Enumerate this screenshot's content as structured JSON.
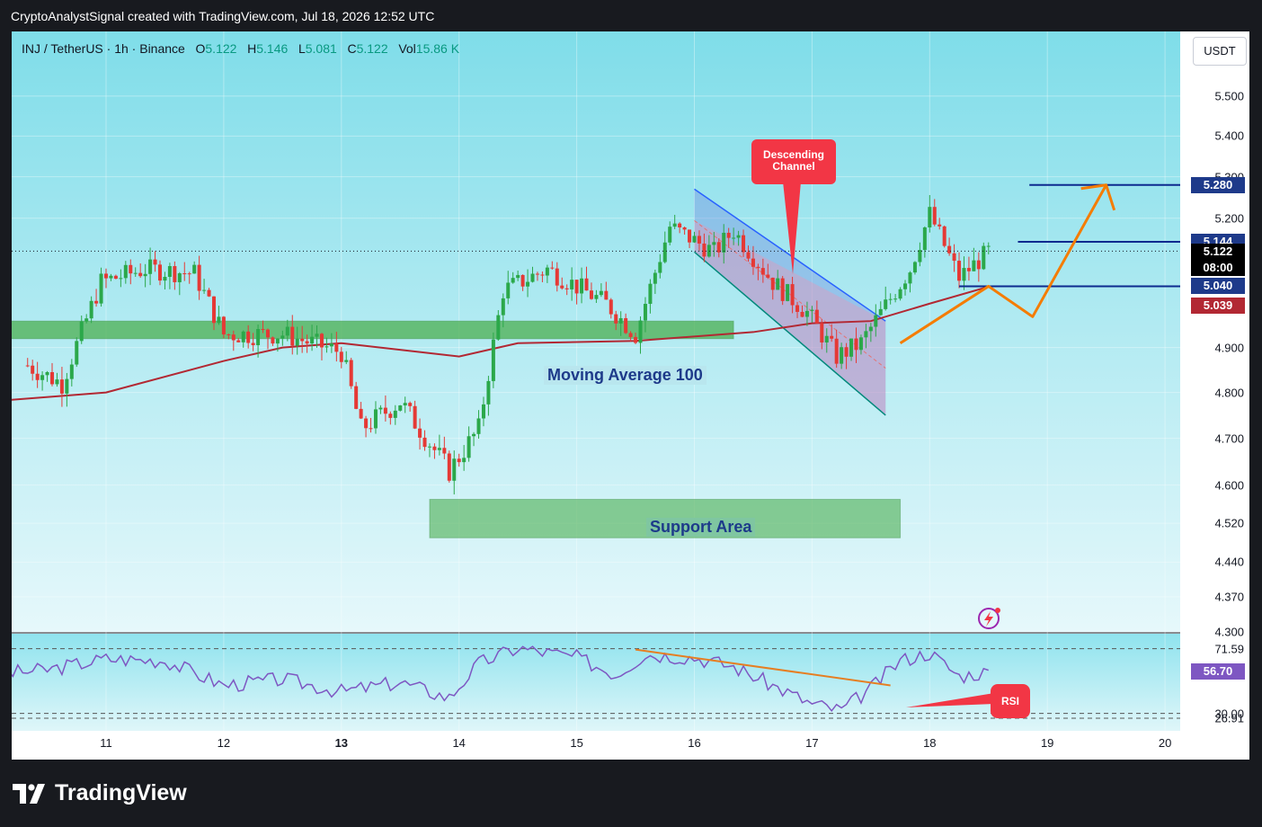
{
  "header": {
    "attribution": "CryptoAnalystSignal created with TradingView.com, Jul 18, 2026 12:52 UTC"
  },
  "symbol": {
    "name": "INJ / TetherUS · 1h · Binance",
    "o_label": "O",
    "o": "5.122",
    "h_label": "H",
    "h": "5.146",
    "l_label": "L",
    "l": "5.081",
    "c_label": "C",
    "c": "5.122",
    "vol_label": "Vol",
    "vol": "15.86 K"
  },
  "currency_button": "USDT",
  "price_axis": {
    "ticks": [
      "5.500",
      "5.400",
      "5.300",
      "5.200",
      "4.900",
      "4.800",
      "4.700",
      "4.600",
      "4.520",
      "4.440",
      "4.370",
      "4.300"
    ],
    "badges": [
      {
        "label": "5.280",
        "color": "#1e3a8a"
      },
      {
        "label": "5.144",
        "color": "#1e3a8a"
      },
      {
        "label": "5.122",
        "color": "#000000"
      },
      {
        "label": "08:00",
        "color": "#000000"
      },
      {
        "label": "5.040",
        "color": "#1e3a8a"
      },
      {
        "label": "5.039",
        "color": "#b22833"
      }
    ]
  },
  "rsi_axis": {
    "ticks": [
      "71.59",
      "30.00",
      "26.91"
    ],
    "badge": {
      "label": "56.70",
      "color": "#7e57c2"
    }
  },
  "time_axis": {
    "labels": [
      "11",
      "12",
      "13",
      "14",
      "15",
      "16",
      "17",
      "18",
      "19",
      "20"
    ]
  },
  "annotations": {
    "moving_average": "Moving Average 100",
    "support_area": "Support Area",
    "descending_channel": [
      "Descending",
      "Channel"
    ],
    "rsi": "RSI"
  },
  "colors": {
    "background_top": "#7fdde9",
    "background_bottom": "#e0f7fa",
    "up": "#2ba84a",
    "down": "#e53935",
    "ma": "#b22833",
    "rsi_line": "#7e57c2",
    "zone": "#4caf50",
    "projection": "#f57c00",
    "level_line": "#0d2a8f"
  },
  "icons": [
    "tradingview-logo-icon",
    "alert-bolt-icon"
  ],
  "chart_data": {
    "type": "candlestick",
    "symbol": "INJ / TetherUS",
    "interval": "1h",
    "exchange": "Binance",
    "time_range": [
      "2026-07-10",
      "2026-07-20"
    ],
    "ylim": [
      4.3,
      5.55
    ],
    "price_path": [
      [
        "2026-07-10T08:00",
        4.86
      ],
      [
        "2026-07-10T15:00",
        4.82
      ],
      [
        "2026-07-10T23:00",
        5.05
      ],
      [
        "2026-07-11T08:00",
        5.08
      ],
      [
        "2026-07-11T18:00",
        5.07
      ],
      [
        "2026-07-12T00:00",
        4.93
      ],
      [
        "2026-07-12T12:00",
        4.93
      ],
      [
        "2026-07-13T00:00",
        4.89
      ],
      [
        "2026-07-13T04:00",
        4.72
      ],
      [
        "2026-07-13T12:00",
        4.78
      ],
      [
        "2026-07-13T22:00",
        4.63
      ],
      [
        "2026-07-14T04:00",
        4.72
      ],
      [
        "2026-07-14T09:00",
        5.03
      ],
      [
        "2026-07-14T18:00",
        5.08
      ],
      [
        "2026-07-15T06:00",
        5.0
      ],
      [
        "2026-07-15T12:00",
        4.93
      ],
      [
        "2026-07-15T19:00",
        5.18
      ],
      [
        "2026-07-16T04:00",
        5.12
      ],
      [
        "2026-07-16T08:00",
        5.17
      ],
      [
        "2026-07-16T16:00",
        5.05
      ],
      [
        "2026-07-16T23:00",
        4.98
      ],
      [
        "2026-07-17T05:00",
        4.88
      ],
      [
        "2026-07-17T10:00",
        4.91
      ],
      [
        "2026-07-17T20:00",
        5.08
      ],
      [
        "2026-07-18T00:00",
        5.21
      ],
      [
        "2026-07-18T06:00",
        5.06
      ],
      [
        "2026-07-18T12:00",
        5.12
      ]
    ],
    "moving_average_100": [
      [
        "2026-07-10T00:00",
        4.78
      ],
      [
        "2026-07-11T00:00",
        4.8
      ],
      [
        "2026-07-12T00:00",
        4.87
      ],
      [
        "2026-07-12T12:00",
        4.9
      ],
      [
        "2026-07-13T00:00",
        4.91
      ],
      [
        "2026-07-14T00:00",
        4.88
      ],
      [
        "2026-07-14T12:00",
        4.91
      ],
      [
        "2026-07-15T12:00",
        4.915
      ],
      [
        "2026-07-16T12:00",
        4.935
      ],
      [
        "2026-07-17T00:00",
        4.955
      ],
      [
        "2026-07-17T12:00",
        4.96
      ],
      [
        "2026-07-18T00:00",
        5.0
      ],
      [
        "2026-07-18T12:00",
        5.039
      ]
    ],
    "zones": [
      {
        "name": "Moving Average 100",
        "from": "2026-07-10T00:00",
        "to": "2026-07-16T08:00",
        "low": 4.92,
        "high": 4.96
      },
      {
        "name": "Support Area",
        "from": "2026-07-13T18:00",
        "to": "2026-07-17T18:00",
        "low": 4.49,
        "high": 4.57
      }
    ],
    "descending_channel": {
      "upper": [
        [
          "2026-07-16T00:00",
          5.27
        ],
        [
          "2026-07-17T15:00",
          4.96
        ]
      ],
      "lower": [
        [
          "2026-07-16T00:00",
          5.12
        ],
        [
          "2026-07-17T15:00",
          4.75
        ]
      ]
    },
    "levels": [
      5.28,
      5.144,
      5.04
    ],
    "last_price": 5.122,
    "projection": [
      [
        "2026-07-17T18:00",
        4.91
      ],
      [
        "2026-07-18T12:00",
        5.04
      ],
      [
        "2026-07-18T21:00",
        4.97
      ],
      [
        "2026-07-19T12:00",
        5.28
      ]
    ],
    "rsi": {
      "ylim": [
        20,
        80
      ],
      "levels": [
        71.59,
        30.0,
        26.91
      ],
      "last": 56.7,
      "series": [
        [
          "2026-07-10T00:00",
          55
        ],
        [
          "2026-07-10T12:00",
          58
        ],
        [
          "2026-07-11T00:00",
          65
        ],
        [
          "2026-07-11T12:00",
          64
        ],
        [
          "2026-07-12T00:00",
          48
        ],
        [
          "2026-07-12T12:00",
          52
        ],
        [
          "2026-07-13T00:00",
          44
        ],
        [
          "2026-07-13T12:00",
          50
        ],
        [
          "2026-07-13T22:00",
          40
        ],
        [
          "2026-07-14T04:00",
          62
        ],
        [
          "2026-07-14T12:00",
          72
        ],
        [
          "2026-07-15T00:00",
          66
        ],
        [
          "2026-07-15T08:00",
          55
        ],
        [
          "2026-07-15T14:00",
          68
        ],
        [
          "2026-07-16T00:00",
          66
        ],
        [
          "2026-07-16T08:00",
          60
        ],
        [
          "2026-07-16T16:00",
          48
        ],
        [
          "2026-07-17T00:00",
          36
        ],
        [
          "2026-07-17T06:00",
          32
        ],
        [
          "2026-07-17T12:00",
          46
        ],
        [
          "2026-07-17T18:00",
          64
        ],
        [
          "2026-07-18T00:00",
          69
        ],
        [
          "2026-07-18T06:00",
          54
        ],
        [
          "2026-07-18T12:00",
          56.7
        ]
      ],
      "trendline": [
        [
          "2026-07-15T12:00",
          71
        ],
        [
          "2026-07-17T16:00",
          48
        ]
      ]
    }
  }
}
